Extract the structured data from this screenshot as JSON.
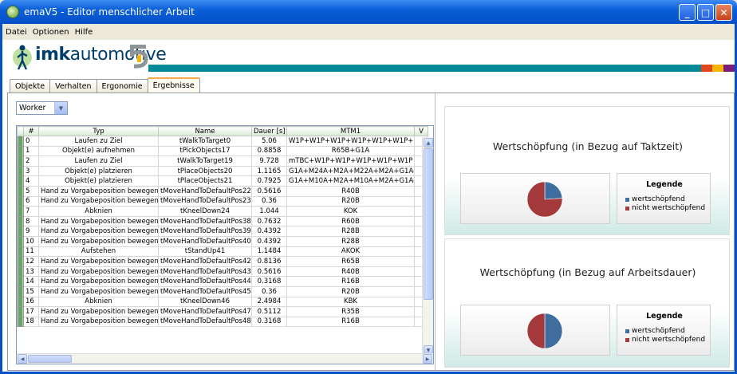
{
  "window": {
    "title": "emaV5 - Editor menschlicher Arbeit"
  },
  "menu": [
    "Datei",
    "Optionen",
    "Hilfe"
  ],
  "logo": {
    "brand_bold": "imk",
    "brand_rest": "automotive"
  },
  "brand_colors": [
    "#e0451b",
    "#f7b500",
    "#7b1d7a"
  ],
  "tabs": [
    "Objekte",
    "Verhalten",
    "Ergonomie",
    "Ergebnisse"
  ],
  "active_tab": "Ergebnisse",
  "worker_select": {
    "value": "Worker"
  },
  "table": {
    "columns": [
      "#",
      "Typ",
      "Name",
      "Dauer [s]",
      "MTM1",
      "V"
    ],
    "rows": [
      [
        "0",
        "Laufen zu Ziel",
        "tWalkToTarget0",
        "5.06",
        "W1P+W1P+W1P+W1P+W1P+W1P+"
      ],
      [
        "1",
        "Objekt(e) aufnehmen",
        "tPickObjects17",
        "0.8858",
        "R65B+G1A"
      ],
      [
        "2",
        "Laufen zu Ziel",
        "tWalkToTarget19",
        "9.728",
        "mTBC+W1P+W1P+W1P+W1P+W1P"
      ],
      [
        "3",
        "Objekt(e) platzieren",
        "tPlaceObjects20",
        "1.1165",
        "G1A+M24A+M2A+M22A+M2A+G1A-"
      ],
      [
        "4",
        "Objekt(e) platzieren",
        "tPlaceObjects21",
        "0.7925",
        "G1A+M10A+M2A+M10A+M2A+G1A-"
      ],
      [
        "5",
        "Hand zu Vorgabeposition bewegen",
        "tMoveHandToDefaultPos22",
        "0.5616",
        "R40B"
      ],
      [
        "6",
        "Hand zu Vorgabeposition bewegen",
        "tMoveHandToDefaultPos23",
        "0.36",
        "R20B"
      ],
      [
        "7",
        "Abknien",
        "tKneelDown24",
        "1.044",
        "KOK"
      ],
      [
        "8",
        "Hand zu Vorgabeposition bewegen",
        "tMoveHandToDefaultPos38",
        "0.7632",
        "R60B"
      ],
      [
        "9",
        "Hand zu Vorgabeposition bewegen",
        "tMoveHandToDefaultPos39",
        "0.4392",
        "R28B"
      ],
      [
        "10",
        "Hand zu Vorgabeposition bewegen",
        "tMoveHandToDefaultPos40",
        "0.4392",
        "R28B"
      ],
      [
        "11",
        "Aufstehen",
        "tStandUp41",
        "1.1484",
        "AKOK"
      ],
      [
        "12",
        "Hand zu Vorgabeposition bewegen",
        "tMoveHandToDefaultPos42",
        "0.8136",
        "R65B"
      ],
      [
        "13",
        "Hand zu Vorgabeposition bewegen",
        "tMoveHandToDefaultPos43",
        "0.5616",
        "R40B"
      ],
      [
        "14",
        "Hand zu Vorgabeposition bewegen",
        "tMoveHandToDefaultPos44",
        "0.3168",
        "R16B"
      ],
      [
        "15",
        "Hand zu Vorgabeposition bewegen",
        "tMoveHandToDefaultPos45",
        "0.36",
        "R20B"
      ],
      [
        "16",
        "Abknien",
        "tKneelDown46",
        "2.4984",
        "KBK"
      ],
      [
        "17",
        "Hand zu Vorgabeposition bewegen",
        "tMoveHandToDefaultPos47",
        "0.5112",
        "R35B"
      ],
      [
        "18",
        "Hand zu Vorgabeposition bewegen",
        "tMoveHandToDefaultPos48",
        "0.3168",
        "R16B"
      ]
    ]
  },
  "charts": [
    {
      "title": "Wertschöpfung (in Bezug auf Taktzeit)",
      "legend_title": "Legende",
      "legend": [
        "wertschöpfend",
        "nicht wertschöpfend"
      ],
      "fractions": [
        0.24,
        0.76
      ]
    },
    {
      "title": "Wertschöpfung (in Bezug auf Arbeitsdauer)",
      "legend_title": "Legende",
      "legend": [
        "wertschöpfend",
        "nicht wertschöpfend"
      ],
      "fractions": [
        0.5,
        0.5
      ]
    }
  ],
  "colors": {
    "value_adding": "#3f6d9e",
    "non_value_adding": "#a3393a"
  }
}
